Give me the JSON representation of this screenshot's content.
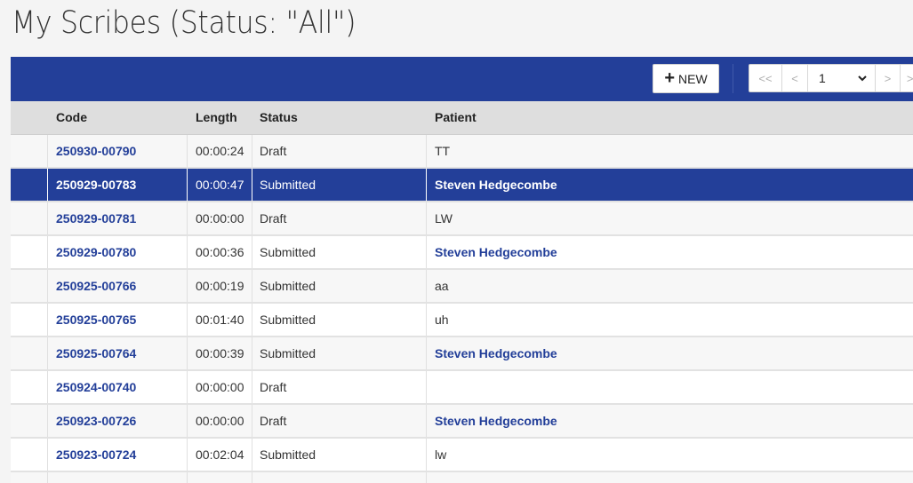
{
  "page": {
    "title": "My Scribes (Status: \"All\")"
  },
  "toolbar": {
    "new_label": "NEW",
    "new_icon": "plus-icon",
    "pager": {
      "first": "<<",
      "prev": "<",
      "page": "1",
      "next": ">",
      "last": ">>"
    }
  },
  "colors": {
    "accent": "#233f99",
    "header_bg": "#dedede"
  },
  "table": {
    "columns": [
      "Code",
      "Length",
      "Status",
      "Patient"
    ],
    "rows": [
      {
        "code": "250930-00790",
        "length": "00:00:24",
        "status": "Draft",
        "patient": "TT",
        "patient_linked": false,
        "selected": false
      },
      {
        "code": "250929-00783",
        "length": "00:00:47",
        "status": "Submitted",
        "patient": "Steven Hedgecombe",
        "patient_linked": true,
        "selected": true
      },
      {
        "code": "250929-00781",
        "length": "00:00:00",
        "status": "Draft",
        "patient": "LW",
        "patient_linked": false,
        "selected": false
      },
      {
        "code": "250929-00780",
        "length": "00:00:36",
        "status": "Submitted",
        "patient": "Steven Hedgecombe",
        "patient_linked": true,
        "selected": false
      },
      {
        "code": "250925-00766",
        "length": "00:00:19",
        "status": "Submitted",
        "patient": "aa",
        "patient_linked": false,
        "selected": false
      },
      {
        "code": "250925-00765",
        "length": "00:01:40",
        "status": "Submitted",
        "patient": "uh",
        "patient_linked": false,
        "selected": false
      },
      {
        "code": "250925-00764",
        "length": "00:00:39",
        "status": "Submitted",
        "patient": "Steven Hedgecombe",
        "patient_linked": true,
        "selected": false
      },
      {
        "code": "250924-00740",
        "length": "00:00:00",
        "status": "Draft",
        "patient": "",
        "patient_linked": false,
        "selected": false
      },
      {
        "code": "250923-00726",
        "length": "00:00:00",
        "status": "Draft",
        "patient": "Steven Hedgecombe",
        "patient_linked": true,
        "selected": false
      },
      {
        "code": "250923-00724",
        "length": "00:02:04",
        "status": "Submitted",
        "patient": "lw",
        "patient_linked": false,
        "selected": false
      },
      {
        "code": "",
        "length": "",
        "status": "",
        "patient": "",
        "patient_linked": false,
        "selected": false
      }
    ]
  }
}
